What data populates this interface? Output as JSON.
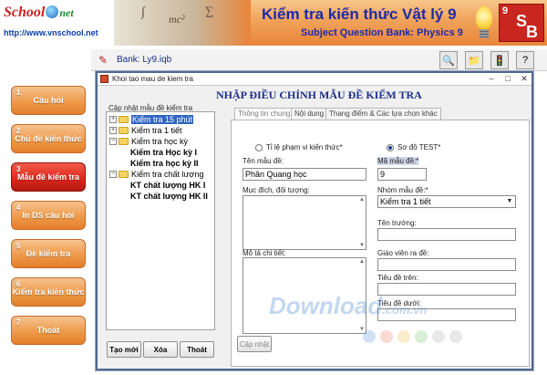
{
  "banner": {
    "logo_school": "School",
    "logo_net": "net",
    "url": "http://www.vnschool.net",
    "title_vn": "Kiểm tra kiến thức Vật lý 9",
    "title_en": "Subject Question Bank: Physics 9",
    "badge_number": "9",
    "badge_s": "S",
    "badge_b": "B"
  },
  "toolbar": {
    "bank_label": "Bank:",
    "bank_file": "Ly9.iqb",
    "icons": [
      "search-icon",
      "folder-icon",
      "traffic-light-icon",
      "help-icon"
    ]
  },
  "nav": {
    "items": [
      {
        "num": "1",
        "label": "Câu hỏi"
      },
      {
        "num": "2",
        "label": "Chủ đề kiến thức"
      },
      {
        "num": "3",
        "label": "Mẫu đề kiểm tra"
      },
      {
        "num": "4",
        "label": "In DS câu hỏi"
      },
      {
        "num": "5",
        "label": "Đề kiểm tra"
      },
      {
        "num": "6",
        "label": "Kiểm tra kiến thức"
      },
      {
        "num": "7",
        "label": "Thoát"
      }
    ]
  },
  "dialog": {
    "window_title": "Khoi tao mau de kiem tra",
    "header": "NHẬP ĐIỀU CHỈNH MẪU ĐỀ KIỂM TRA",
    "tree_legend": "Cập nhật mẫu đề kiểm tra",
    "tree": [
      {
        "label": "Kiểm tra 15 phút"
      },
      {
        "label": "Kiểm tra 1 tiết"
      },
      {
        "label": "Kiểm tra học kỳ"
      },
      {
        "label": "Kiểm tra Học kỳ I"
      },
      {
        "label": "Kiểm tra học kỳ II"
      },
      {
        "label": "Kiểm tra chất lượng"
      },
      {
        "label": "KT chất lượng HK I"
      },
      {
        "label": "KT chất lượng HK II"
      }
    ],
    "buttons": {
      "new": "Tạo mới",
      "delete": "Xóa",
      "exit": "Thoát",
      "update": "Cập nhật"
    },
    "tabs": [
      "Thông tin chung",
      "Nội dung",
      "Thang điểm & Các lựa chọn khác"
    ],
    "form": {
      "radio_range": "Tỉ lệ phạm vi kiến thức*",
      "radio_diagram": "Sơ đồ TEST*",
      "name_label": "Tên mẫu đề:",
      "name_value": "Phần Quang học",
      "code_label": "Mã mẫu đề:*",
      "code_value": "9",
      "purpose_label": "Mục đích, đối tượng:",
      "group_label": "Nhóm mẫu đề:*",
      "group_value": "Kiểm tra 1 tiết",
      "school_label": "Tên trường:",
      "detail_label": "Mô tả chi tiết:",
      "teacher_label": "Giáo viên ra đề:",
      "top_title_label": "Tiêu đề trên:",
      "bottom_title_label": "Tiêu đề dưới:"
    }
  },
  "watermark": {
    "text": "Download",
    "domain": ".com.vn"
  },
  "colors": {
    "nav_orange": "#ee9a4a",
    "nav_active_red": "#d9261b",
    "title_blue": "#1d2aa8",
    "selection_blue": "#3166c3"
  }
}
